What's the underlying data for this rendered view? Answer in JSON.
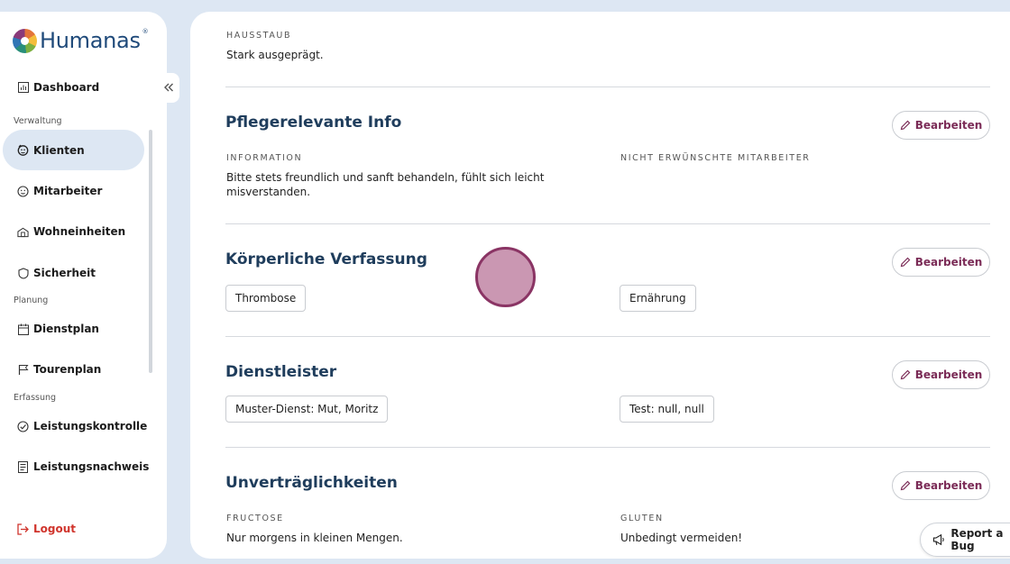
{
  "app": {
    "brand": "Humanas",
    "brand_mark": "®"
  },
  "sidebar": {
    "dashboard": "Dashboard",
    "sections": {
      "verwaltung": "Verwaltung",
      "planung": "Planung",
      "erfassung": "Erfassung"
    },
    "items": [
      {
        "label": "Klienten",
        "icon": "user-group-icon",
        "active": true
      },
      {
        "label": "Mitarbeiter",
        "icon": "smiley-icon"
      },
      {
        "label": "Wohneinheiten",
        "icon": "building-icon"
      },
      {
        "label": "Sicherheit",
        "icon": "shield-icon"
      },
      {
        "label": "Dienstplan",
        "icon": "calendar-icon"
      },
      {
        "label": "Tourenplan",
        "icon": "flag-icon"
      },
      {
        "label": "Leistungskontrolle",
        "icon": "check-circle-icon"
      },
      {
        "label": "Leistungsnachweis",
        "icon": "receipt-icon"
      }
    ],
    "logout": "Logout"
  },
  "main": {
    "hausstaub": {
      "label": "HAUSSTAUB",
      "value": "Stark ausgeprägt."
    },
    "pflege": {
      "title": "Pflegerelevante Info",
      "edit": "Bearbeiten",
      "info_label": "INFORMATION",
      "info_value": "Bitte stets freundlich und sanft behandeln, fühlt sich leicht misverstanden.",
      "excluded_label": "NICHT ERWÜNSCHTE MITARBEITER"
    },
    "koerper": {
      "title": "Körperliche Verfassung",
      "edit": "Bearbeiten",
      "chips": [
        "Thrombose",
        "Ernährung"
      ]
    },
    "dienst": {
      "title": "Dienstleister",
      "edit": "Bearbeiten",
      "chips": [
        "Muster-Dienst: Mut, Moritz",
        "Test: null, null"
      ]
    },
    "unvertr": {
      "title": "Unverträglichkeiten",
      "edit": "Bearbeiten",
      "items": [
        {
          "label": "FRUCTOSE",
          "value": "Nur morgens in kleinen Mengen."
        },
        {
          "label": "GLUTEN",
          "value": "Unbedingt vermeiden!"
        }
      ]
    }
  },
  "report_bug": "Report a Bug",
  "colors": {
    "accent": "#7b2c57",
    "title": "#1f3d5c",
    "danger": "#d0342c",
    "bg": "#dde7f3"
  }
}
